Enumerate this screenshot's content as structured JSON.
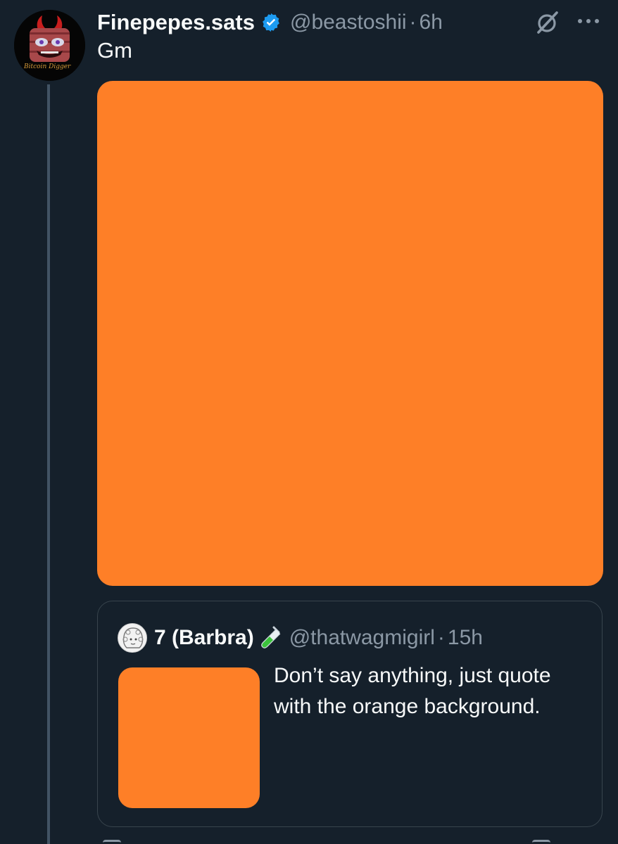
{
  "tweet": {
    "display_name": "Finepepes.sats",
    "handle": "@beastoshii",
    "separator": "·",
    "time": "6h",
    "text": "Gm",
    "avatar_caption": "Bitcoin Digger",
    "media_color": "#fe7f27"
  },
  "quote": {
    "display_name": "7 (Barbra)",
    "handle": "@thatwagmigirl",
    "separator": "·",
    "time": "15h",
    "text": "Don’t say anything, just quote with the orange background.",
    "media_color": "#fe7f27"
  },
  "icons": {
    "verified": "verified-badge-icon",
    "grok": "grok-icon",
    "more": "more-icon",
    "test_tube": "test-tube-icon"
  },
  "colors": {
    "background": "#15202b",
    "accent_blue": "#1d9bf0",
    "secondary_text": "#8b98a5",
    "orange": "#fe7f27"
  }
}
